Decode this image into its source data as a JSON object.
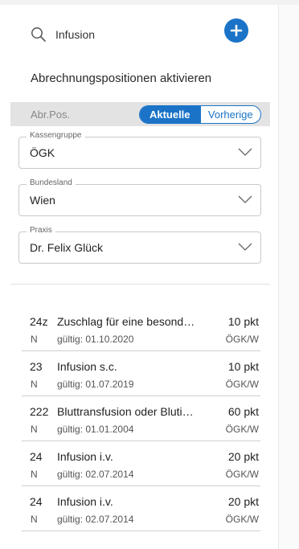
{
  "search": {
    "query": "Infusion"
  },
  "section_title": "Abrechnungspositionen aktivieren",
  "tabs": {
    "label": "Abr.Pos.",
    "active": "Aktuelle",
    "inactive": "Vorherige"
  },
  "fields": [
    {
      "label": "Kassengruppe",
      "value": "ÖGK"
    },
    {
      "label": "Bundesland",
      "value": "Wien"
    },
    {
      "label": "Praxis",
      "value": "Dr. Felix Glück"
    }
  ],
  "items": [
    {
      "code": "24z",
      "title": "Zuschlag für eine besonderen",
      "points": "10 pkt",
      "flag": "N",
      "valid": "gültig: 01.10.2020",
      "region": "ÖGK/W"
    },
    {
      "code": "23",
      "title": "Infusion s.c.",
      "points": "10 pkt",
      "flag": "N",
      "valid": "gültig: 01.07.2019",
      "region": "ÖGK/W"
    },
    {
      "code": "222",
      "title": "Bluttransfusion oder Blutinfusion",
      "points": "60 pkt",
      "flag": "N",
      "valid": "gültig: 01.01.2004",
      "region": "ÖGK/W"
    },
    {
      "code": "24",
      "title": "Infusion i.v.",
      "points": "20 pkt",
      "flag": "N",
      "valid": "gültig: 02.07.2014",
      "region": "ÖGK/W"
    },
    {
      "code": "24",
      "title": "Infusion i.v.",
      "points": "20 pkt",
      "flag": "N",
      "valid": "gültig: 02.07.2014",
      "region": "ÖGK/W"
    }
  ],
  "colors": {
    "accent": "#1a73c7",
    "bar": "#e3e3e3",
    "divider": "#cfcfcf"
  },
  "icons": {
    "search": "search-icon",
    "add": "plus-icon",
    "dropdown": "chevron-down-icon"
  }
}
